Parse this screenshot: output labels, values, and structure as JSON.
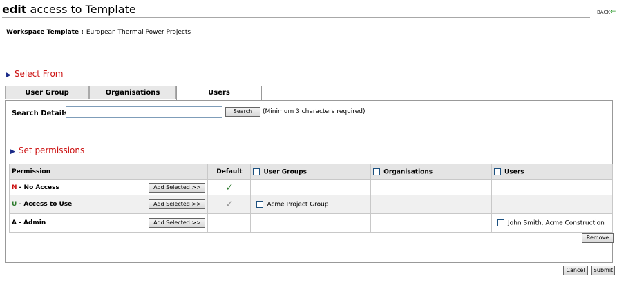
{
  "page": {
    "title_bold": "edit",
    "title_rest": " access to Template",
    "back_label": "BACK"
  },
  "workspace": {
    "label": "Workspace Template :",
    "value": "European Thermal Power Projects"
  },
  "select_from": {
    "heading": "Select From"
  },
  "tabs": [
    {
      "label": "User Group",
      "active": false
    },
    {
      "label": "Organisations",
      "active": false
    },
    {
      "label": "Users",
      "active": true
    }
  ],
  "search": {
    "label": "Search Details:",
    "value": "",
    "placeholder": "",
    "button": "Search",
    "hint": "(Minimum 3 characters required)"
  },
  "set_permissions": {
    "heading": "Set permissions"
  },
  "permissions_table": {
    "headers": {
      "permission": "Permission",
      "default": "Default",
      "user_groups": "User Groups",
      "organisations": "Organisations",
      "users": "Users"
    },
    "rows": [
      {
        "code": "N",
        "code_color": "#cc1111",
        "name": " - No Access",
        "add_button": "Add Selected >>",
        "default": "green-check",
        "user_groups": "",
        "organisations": "",
        "users": ""
      },
      {
        "code": "U",
        "code_color": "#2c7a2c",
        "name": " - Access to Use",
        "add_button": "Add Selected >>",
        "default": "grey-check",
        "user_groups": "Acme Project Group",
        "organisations": "",
        "users": ""
      },
      {
        "code": "A",
        "code_color": "#000000",
        "name": " - Admin",
        "add_button": "Add Selected >>",
        "default": "",
        "user_groups": "",
        "organisations": "",
        "users": "John Smith, Acme Construction"
      }
    ]
  },
  "buttons": {
    "remove": "Remove",
    "cancel": "Cancel",
    "submit": "Submit"
  },
  "colors": {
    "heading_red": "#cc1111",
    "triangle_blue": "#1a2a88",
    "header_grey": "#e4e4e4"
  }
}
